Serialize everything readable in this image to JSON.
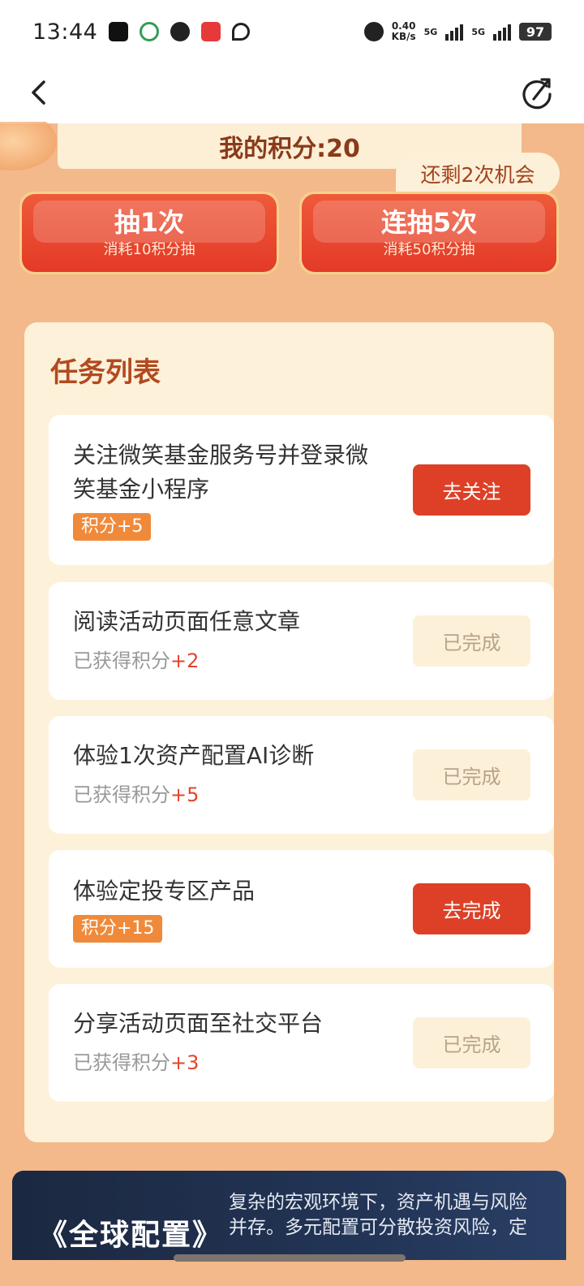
{
  "status_bar": {
    "time": "13:44",
    "net_speed_value": "0.40",
    "net_speed_unit": "KB/s",
    "network_1": "5G",
    "network_2": "5G",
    "battery": "97"
  },
  "header": {
    "points_label": "我的积分:20",
    "chance_tag": "还剩2次机会"
  },
  "draw_buttons": [
    {
      "title": "抽1次",
      "subtitle": "消耗10积分抽"
    },
    {
      "title": "连抽5次",
      "subtitle": "消耗50积分抽"
    }
  ],
  "task_panel": {
    "heading": "任务列表",
    "tasks": [
      {
        "title_line1": "关注微笑基金服务号并登录微",
        "title_line2": "笑基金小程序",
        "badge": "积分+5",
        "button": "去关注",
        "state": "active"
      },
      {
        "title_line1": "阅读活动页面任意文章",
        "earned_prefix": "已获得积分",
        "earned_value": "+2",
        "button": "已完成",
        "state": "done"
      },
      {
        "title_line1": "体验1次资产配置AI诊断",
        "earned_prefix": "已获得积分",
        "earned_value": "+5",
        "button": "已完成",
        "state": "done"
      },
      {
        "title_line1": "体验定投专区产品",
        "badge": "积分+15",
        "button": "去完成",
        "state": "active"
      },
      {
        "title_line1": "分享活动页面至社交平台",
        "earned_prefix": "已获得积分",
        "earned_value": "+3",
        "button": "已完成",
        "state": "done"
      }
    ]
  },
  "banner": {
    "title": "《全球配置》",
    "text_line1": "复杂的宏观环境下，资产机遇与风险",
    "text_line2": "并存。多元配置可分散投资风险，定"
  },
  "colors": {
    "page_bg": "#f3b98a",
    "panel_bg": "#fdf1da",
    "accent_red": "#dd4027",
    "badge_orange": "#f08a3a",
    "heading_brown": "#b24a1f"
  }
}
